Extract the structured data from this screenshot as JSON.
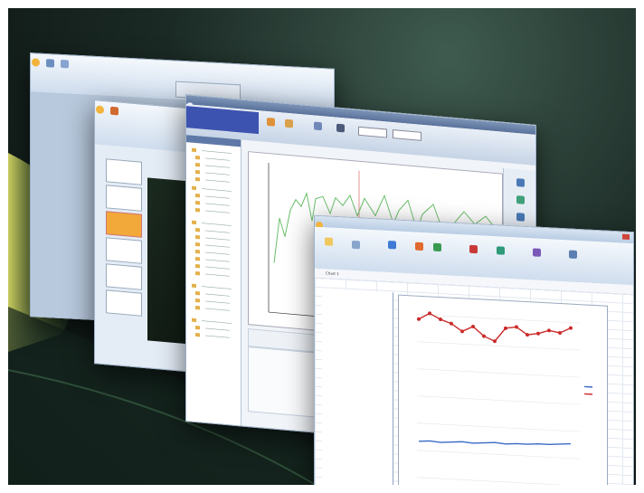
{
  "scene": {
    "description_free": true,
    "background_colors": {
      "dark": "#0a110f",
      "green": "#3f5b4f",
      "swoosh": "#c9d86a"
    }
  },
  "windows": {
    "word": {
      "app_icon": "office-button-icon"
    },
    "powerpoint": {
      "app_icon": "office-button-icon"
    },
    "analyzer": {
      "app_icon": "spectrum-app-icon"
    },
    "excel": {
      "app_icon": "office-button-icon",
      "name_box": "Chart 1"
    }
  },
  "colors": {
    "accent": "#4a79b5",
    "red_series": "#cc2b2b",
    "blue_series": "#3a6bc4",
    "green_line": "#6cc06c",
    "marker": "#e07a7a"
  }
}
